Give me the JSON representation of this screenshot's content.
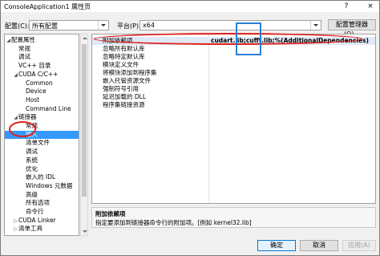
{
  "window": {
    "title": "ConsoleApplication1 属性页",
    "help": "?",
    "close": "×"
  },
  "toolbar": {
    "config_label": "配置(C):",
    "config_value": "所有配置",
    "platform_label": "平台(P):",
    "platform_value": "x64",
    "config_manager": "配置管理器(O)..."
  },
  "tree": {
    "items": [
      {
        "label": "配置属性",
        "exp": "◢",
        "indent": 0
      },
      {
        "label": "常规",
        "exp": "",
        "indent": 1
      },
      {
        "label": "调试",
        "exp": "",
        "indent": 1
      },
      {
        "label": "VC++ 目录",
        "exp": "",
        "indent": 1
      },
      {
        "label": "CUDA C/C++",
        "exp": "◢",
        "indent": 1
      },
      {
        "label": "Common",
        "exp": "",
        "indent": 2
      },
      {
        "label": "Device",
        "exp": "",
        "indent": 2
      },
      {
        "label": "Host",
        "exp": "",
        "indent": 2
      },
      {
        "label": "Command Line",
        "exp": "",
        "indent": 2
      },
      {
        "label": "链接器",
        "exp": "◢",
        "indent": 1
      },
      {
        "label": "常规",
        "exp": "",
        "indent": 2
      },
      {
        "label": "输入",
        "exp": "",
        "indent": 2,
        "selected": true
      },
      {
        "label": "清单文件",
        "exp": "",
        "indent": 2
      },
      {
        "label": "调试",
        "exp": "",
        "indent": 2
      },
      {
        "label": "系统",
        "exp": "",
        "indent": 2
      },
      {
        "label": "优化",
        "exp": "",
        "indent": 2
      },
      {
        "label": "嵌入的 IDL",
        "exp": "",
        "indent": 2
      },
      {
        "label": "Windows 元数据",
        "exp": "",
        "indent": 2
      },
      {
        "label": "高级",
        "exp": "",
        "indent": 2
      },
      {
        "label": "所有选项",
        "exp": "",
        "indent": 2
      },
      {
        "label": "命令行",
        "exp": "",
        "indent": 2
      },
      {
        "label": "CUDA Linker",
        "exp": "▷",
        "indent": 1
      },
      {
        "label": "清单工具",
        "exp": "▷",
        "indent": 1
      }
    ]
  },
  "props": {
    "rows": [
      {
        "name": "附加依赖项",
        "value": "cudart.lib;cufft.lib;%(AdditionalDependencies)",
        "selected": true
      },
      {
        "name": "忽略所有默认库",
        "value": ""
      },
      {
        "name": "忽略特定默认库",
        "value": ""
      },
      {
        "name": "模块定义文件",
        "value": ""
      },
      {
        "name": "将模块添加到程序集",
        "value": ""
      },
      {
        "name": "嵌入托管资源文件",
        "value": ""
      },
      {
        "name": "强制符号引用",
        "value": ""
      },
      {
        "name": "延迟加载的 DLL",
        "value": ""
      },
      {
        "name": "程序集链接资源",
        "value": ""
      }
    ]
  },
  "description": {
    "title": "附加依赖项",
    "text": "指定要添加到链接器命令行的附加项。[例如 kernel32.lib]"
  },
  "buttons": {
    "ok": "确定",
    "cancel": "取消",
    "apply": "应用(A)"
  }
}
